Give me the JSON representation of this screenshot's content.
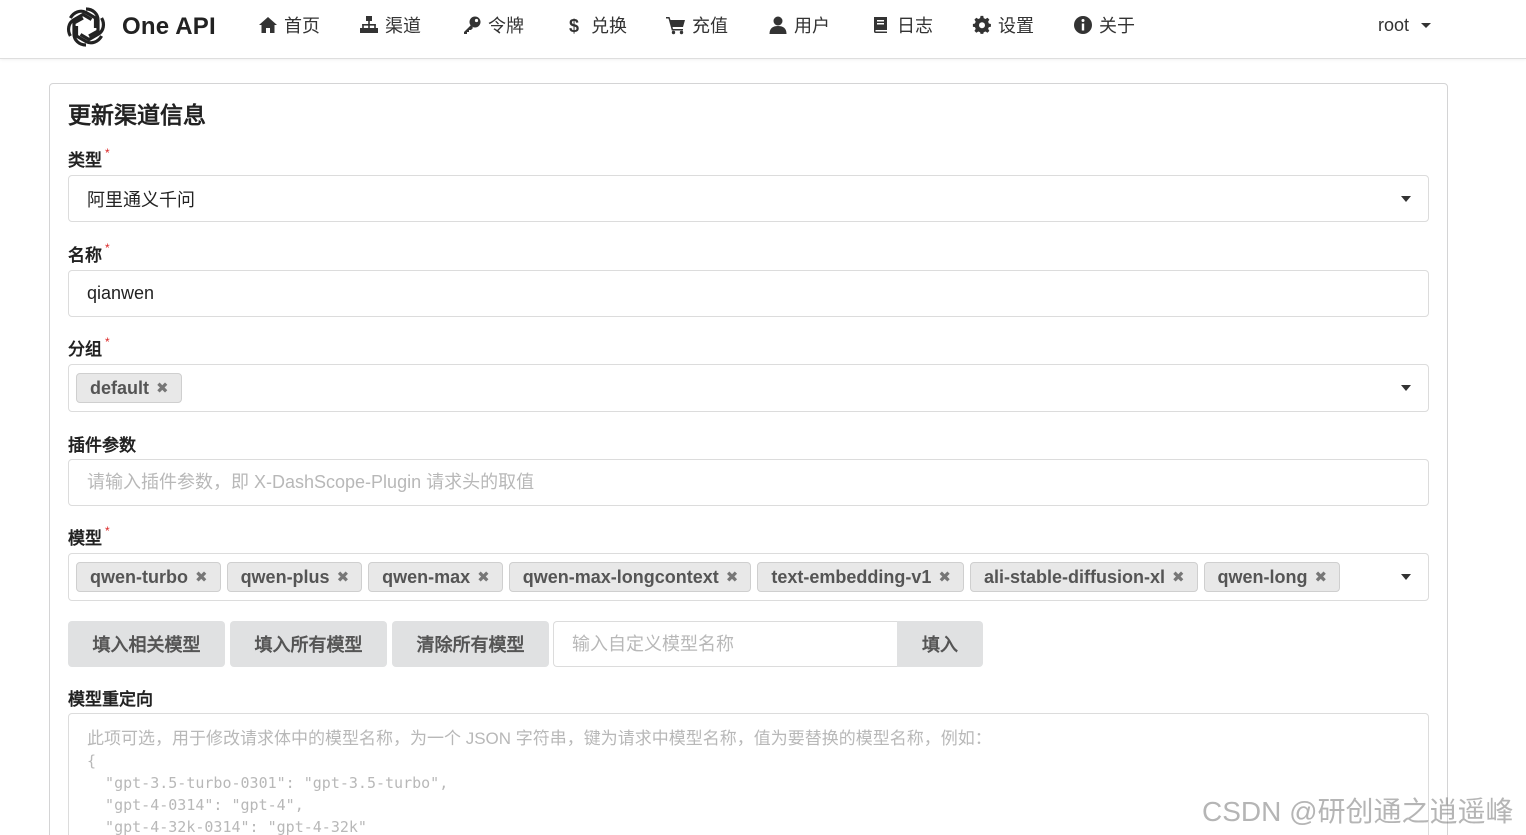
{
  "brand": {
    "name": "One API",
    "logo_icon": "openai-logo-icon"
  },
  "nav": {
    "items": [
      {
        "label": "首页",
        "icon": "home-icon"
      },
      {
        "label": "渠道",
        "icon": "sitemap-icon"
      },
      {
        "label": "令牌",
        "icon": "key-icon"
      },
      {
        "label": "兑换",
        "icon": "dollar-icon"
      },
      {
        "label": "充值",
        "icon": "cart-icon"
      },
      {
        "label": "用户",
        "icon": "user-icon"
      },
      {
        "label": "日志",
        "icon": "book-icon"
      },
      {
        "label": "设置",
        "icon": "gear-icon"
      },
      {
        "label": "关于",
        "icon": "info-icon"
      }
    ],
    "user": "root"
  },
  "form": {
    "title": "更新渠道信息",
    "type": {
      "label": "类型",
      "value": "阿里通义千问"
    },
    "name": {
      "label": "名称",
      "value": "qianwen"
    },
    "group": {
      "label": "分组",
      "tags": [
        "default"
      ]
    },
    "plugin": {
      "label": "插件参数",
      "placeholder": "请输入插件参数，即 X-DashScope-Plugin 请求头的取值"
    },
    "models": {
      "label": "模型",
      "tags": [
        "qwen-turbo",
        "qwen-plus",
        "qwen-max",
        "qwen-max-longcontext",
        "text-embedding-v1",
        "ali-stable-diffusion-xl",
        "qwen-long"
      ]
    },
    "buttons": {
      "fill_related": "填入相关模型",
      "fill_all": "填入所有模型",
      "clear_all": "清除所有模型",
      "custom_placeholder": "输入自定义模型名称",
      "fill": "填入"
    },
    "redirect": {
      "label": "模型重定向",
      "placeholder_intro": "此项可选，用于修改请求体中的模型名称，为一个 JSON 字符串，键为请求中模型名称，值为要替换的模型名称，例如：",
      "placeholder_code": [
        "{",
        "  \"gpt-3.5-turbo-0301\": \"gpt-3.5-turbo\",",
        "  \"gpt-4-0314\": \"gpt-4\",",
        "  \"gpt-4-32k-0314\": \"gpt-4-32k\""
      ]
    }
  },
  "watermark": "CSDN @研创通之逍遥峰"
}
